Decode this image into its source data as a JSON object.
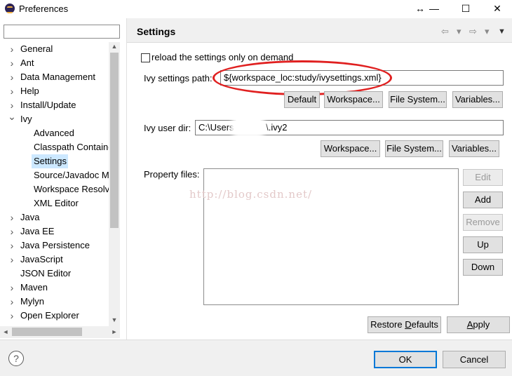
{
  "window": {
    "title": "Preferences",
    "controls": {
      "restore_drag": "↔",
      "minimize": "—",
      "maximize": "☐",
      "close": "✕"
    }
  },
  "filter": {
    "value": "",
    "placeholder": ""
  },
  "tree": {
    "items": [
      {
        "label": "General",
        "level": 0,
        "chevron": "›"
      },
      {
        "label": "Ant",
        "level": 0,
        "chevron": "›"
      },
      {
        "label": "Data Management",
        "level": 0,
        "chevron": "›"
      },
      {
        "label": "Help",
        "level": 0,
        "chevron": "›"
      },
      {
        "label": "Install/Update",
        "level": 0,
        "chevron": "›"
      },
      {
        "label": "Ivy",
        "level": 0,
        "chevron": "⌄"
      },
      {
        "label": "Advanced",
        "level": 1,
        "chevron": ""
      },
      {
        "label": "Classpath Containe",
        "level": 1,
        "chevron": ""
      },
      {
        "label": "Settings",
        "level": 1,
        "chevron": "",
        "selected": true
      },
      {
        "label": "Source/Javadoc M",
        "level": 1,
        "chevron": ""
      },
      {
        "label": "Workspace Resolv",
        "level": 1,
        "chevron": ""
      },
      {
        "label": "XML Editor",
        "level": 1,
        "chevron": ""
      },
      {
        "label": "Java",
        "level": 0,
        "chevron": "›"
      },
      {
        "label": "Java EE",
        "level": 0,
        "chevron": "›"
      },
      {
        "label": "Java Persistence",
        "level": 0,
        "chevron": "›"
      },
      {
        "label": "JavaScript",
        "level": 0,
        "chevron": "›"
      },
      {
        "label": "JSON Editor",
        "level": 0,
        "chevron": ""
      },
      {
        "label": "Maven",
        "level": 0,
        "chevron": "›"
      },
      {
        "label": "Mylyn",
        "level": 0,
        "chevron": "›"
      },
      {
        "label": "Open Explorer",
        "level": 0,
        "chevron": "›"
      }
    ],
    "scroll_up": "▲",
    "scroll_down": "▼",
    "scroll_left": "◄",
    "scroll_right": "►"
  },
  "page": {
    "title": "Settings",
    "nav": {
      "back": "⇦",
      "back_menu": "▾",
      "forward": "⇨",
      "forward_menu": "▾",
      "view_menu": "▼"
    },
    "reload_checkbox": {
      "label": "reload the settings only on demand",
      "checked": false
    },
    "ivy_settings": {
      "label": "Ivy settings path:",
      "value": "${workspace_loc:study/ivysettings.xml}",
      "buttons": {
        "default": "Default",
        "workspace": "Workspace...",
        "file_system": "File System...",
        "variables": "Variables..."
      }
    },
    "ivy_user_dir": {
      "label": "Ivy user dir:",
      "value_prefix": "C:\\Users\\",
      "value_suffix": "\\.ivy2",
      "buttons": {
        "workspace": "Workspace...",
        "file_system": "File System...",
        "variables": "Variables..."
      }
    },
    "property_files": {
      "label": "Property files:",
      "buttons": {
        "edit": "Edit",
        "add": "Add",
        "remove": "Remove",
        "up": "Up",
        "down": "Down"
      }
    },
    "watermark": "http://blog.csdn.net/",
    "restore_defaults": {
      "pre": "Restore ",
      "mnemonic": "D",
      "post": "efaults"
    },
    "apply": {
      "pre": "",
      "mnemonic": "A",
      "post": "pply"
    }
  },
  "footer": {
    "help_icon": "?",
    "ok": "OK",
    "cancel": "Cancel"
  },
  "colors": {
    "highlight_ellipse": "#e02020",
    "selection": "#cce8ff",
    "primary_border": "#0078d7"
  }
}
